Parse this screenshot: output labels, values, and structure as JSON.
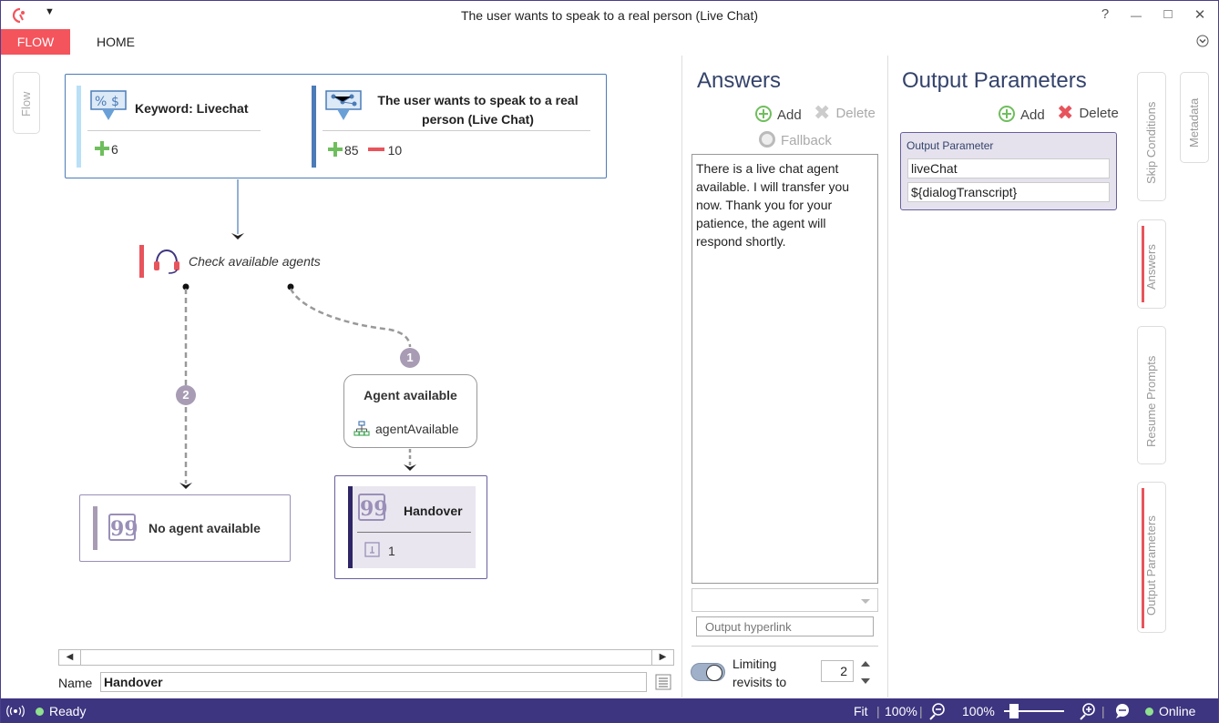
{
  "window": {
    "title": "The user wants to speak to a real person (Live Chat)",
    "help": "?",
    "minimize": "—",
    "maximize": "□",
    "close": "✕",
    "quick_access": "▼"
  },
  "ribbon": {
    "tabs": [
      {
        "label": "FLOW",
        "active": true
      },
      {
        "label": "HOME",
        "active": false
      }
    ]
  },
  "canvas": {
    "side_tab": "Flow",
    "triggers": [
      {
        "title": "Keyword: Livechat",
        "positive": "6",
        "icon": "keyword-percent-dollar-icon",
        "accent": "#b9e0f7"
      },
      {
        "title_line1": "The user wants to speak to a real",
        "title_line2": "person (Live Chat)",
        "positive": "85",
        "negative": "10",
        "icon": "intent-network-icon",
        "accent": "#4b7cb8"
      }
    ],
    "check_node": {
      "label": "Check available agents",
      "icon": "headset-icon"
    },
    "branches": [
      {
        "order": "1",
        "condition_title": "Agent available",
        "condition_var": "agentAvailable"
      },
      {
        "order": "2"
      }
    ],
    "outputs": [
      {
        "title": "No agent available"
      },
      {
        "title": "Handover",
        "count": "1"
      }
    ],
    "name_label": "Name",
    "name_value": "Handover"
  },
  "answers": {
    "title": "Answers",
    "add": "Add",
    "delete": "Delete",
    "fallback": "Fallback",
    "text": "There is a live chat agent available. I will transfer you now. Thank you for your patience, the agent will respond shortly.",
    "hyperlink_placeholder": "Output hyperlink",
    "limit_label_1": "Limiting",
    "limit_label_2": "revisits to",
    "limit_value": "2"
  },
  "output_parameters": {
    "title": "Output Parameters",
    "add": "Add",
    "delete": "Delete",
    "card_header": "Output Parameter",
    "name": "liveChat",
    "value": "${dialogTranscript}"
  },
  "side_tabs": [
    {
      "label": "Skip Conditions",
      "active": false
    },
    {
      "label": "Metadata",
      "active": false
    },
    {
      "label": "Answers",
      "active": true
    },
    {
      "label": "Resume Prompts",
      "active": false
    },
    {
      "label": "Output Parameters",
      "active": true
    }
  ],
  "status": {
    "state": "Ready",
    "fit": "Fit",
    "zoom_left": "100%",
    "zoom_right": "100%",
    "connection": "Online"
  },
  "colors": {
    "accent_red": "#f4545c",
    "status_bar": "#3d3580",
    "panel_title": "#34436b"
  }
}
